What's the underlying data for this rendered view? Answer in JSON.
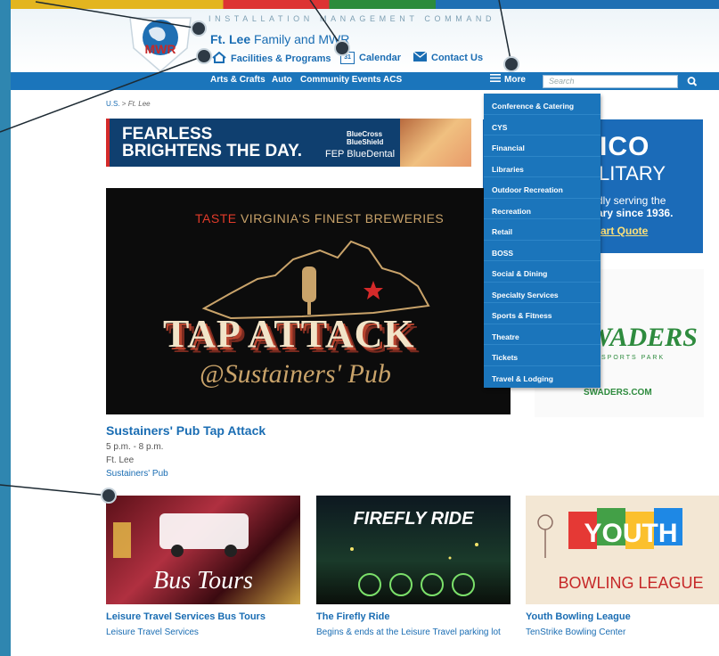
{
  "header": {
    "command_name": "INSTALLATION MANAGEMENT COMMAND",
    "logo_text": "MWR",
    "site_title_bold": "Ft. Lee",
    "site_title_rest": " Family and MWR",
    "links": [
      {
        "label": "Facilities & Programs",
        "icon": "house-icon"
      },
      {
        "label": "Calendar",
        "icon": "calendar-icon",
        "icon_text": "31"
      },
      {
        "label": "Contact Us",
        "icon": "envelope-icon"
      }
    ]
  },
  "nav": {
    "items": [
      "Arts & Crafts",
      "Auto",
      "Community Events",
      "ACS"
    ],
    "more_label": "More",
    "search_placeholder": "Search"
  },
  "more_menu": [
    "Conference & Catering",
    "CYS",
    "Financial",
    "Libraries",
    "Outdoor Recreation",
    "Recreation",
    "Retail",
    "BOSS",
    "Social & Dining",
    "Specialty Services",
    "Sports & Fitness",
    "Theatre",
    "Tickets",
    "Travel & Lodging"
  ],
  "breadcrumb": {
    "root": "U.S.",
    "separator": " > ",
    "current": "Ft. Lee"
  },
  "ads": {
    "bcbs": {
      "headline_1": "FEARLESS",
      "headline_2": "BRIGHTENS THE DAY.",
      "brand_1": "BlueCross",
      "brand_2": "BlueShield",
      "product": "FEP BlueDental"
    },
    "geico": {
      "logo": "EICO",
      "line_1": "LITARY",
      "line_2": "dly serving the",
      "line_3": "ary since 1936.",
      "cta": "tart Quote"
    },
    "swaders": {
      "logo": "WADERS",
      "tagline": "SPORTS PARK",
      "url": "SWADERS.COM"
    }
  },
  "featured": {
    "banner_pre": "TASTE",
    "banner_rest": " VIRGINIA'S FINEST BREWERIES",
    "banner_big": "TAP ATTACK",
    "banner_script": "@Sustainers' Pub",
    "title": "Sustainers' Pub Tap Attack",
    "time": "5 p.m. - 8 p.m.",
    "location": "Ft. Lee",
    "venue": "Sustainers' Pub"
  },
  "cards": [
    {
      "image_text": "Bus Tours",
      "title": "Leisure Travel Services Bus Tours",
      "subtitle": "Leisure Travel Services"
    },
    {
      "image_text": "FIREFLY RIDE",
      "title": "The Firefly Ride",
      "subtitle": "Begins & ends at the Leisure Travel parking lot"
    },
    {
      "image_text_1": "YOUTH",
      "image_text_2": "BOWLING LEAGUE",
      "title": "Youth Bowling League",
      "subtitle": "TenStrike Bowling Center"
    }
  ],
  "colors": {
    "brand_blue": "#1b75bb",
    "link_blue": "#1a6db3",
    "callout": "#2e3a45"
  }
}
